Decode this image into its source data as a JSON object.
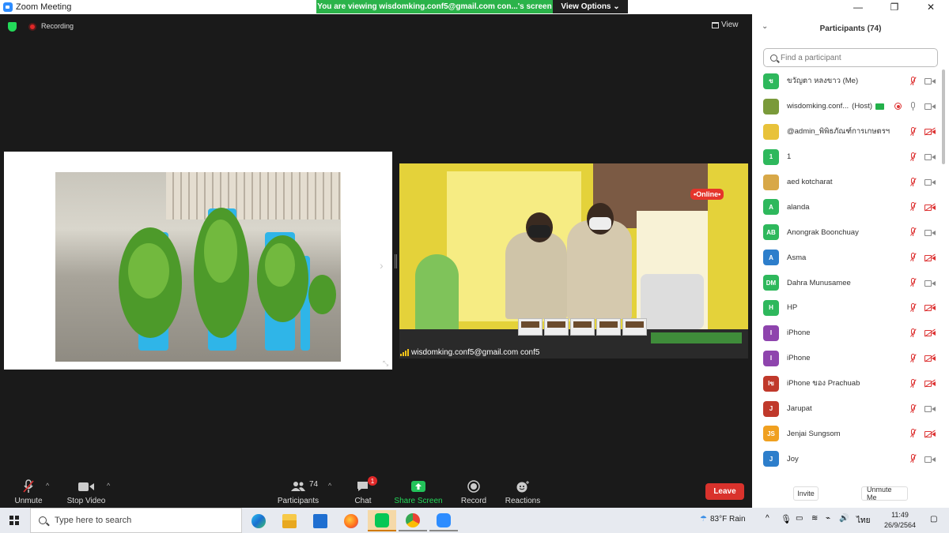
{
  "window": {
    "title": "Zoom Meeting",
    "minimize": "—",
    "maximize": "❐",
    "close": "✕"
  },
  "banner": {
    "text": "You are viewing wisdomking.conf5@gmail.com con...'s screen",
    "view_options": "View Options ⌄"
  },
  "meeting": {
    "recording_label": "Recording",
    "view_label": "View",
    "video_label": "wisdomking.conf5@gmail.com conf5",
    "video_sign_online": "•Online•"
  },
  "toolbar": {
    "unmute": "Unmute",
    "stop_video": "Stop Video",
    "participants": "Participants",
    "participants_count": "74",
    "chat": "Chat",
    "chat_badge": "1",
    "share_screen": "Share Screen",
    "record": "Record",
    "reactions": "Reactions",
    "leave": "Leave"
  },
  "panel": {
    "title": "Participants (74)",
    "search_placeholder": "Find a participant",
    "invite": "Invite",
    "unmute_me": "Unmute Me",
    "participants": [
      {
        "initials": "ข",
        "name": "ขวัญตา หลงขาว (Me)",
        "color": "#2eb85c",
        "mic": "muted",
        "cam": "on"
      },
      {
        "initials": "",
        "name": "wisdomking.conf...",
        "role": "(Host)",
        "color": "#7a9a3a",
        "mic": "on",
        "cam": "on",
        "sharing": true,
        "recording": true
      },
      {
        "initials": "",
        "name": "@admin_พิพิธภัณฑ์การเกษตรฯ",
        "color": "#e8c23a",
        "mic": "muted",
        "cam": "off"
      },
      {
        "initials": "1",
        "name": "1",
        "color": "#2eb85c",
        "mic": "muted",
        "cam": "on"
      },
      {
        "initials": "",
        "name": "aed kotcharat",
        "color": "#d8a848",
        "mic": "muted",
        "cam": "on"
      },
      {
        "initials": "A",
        "name": "alanda",
        "color": "#2eb85c",
        "mic": "muted",
        "cam": "off"
      },
      {
        "initials": "AB",
        "name": "Anongrak Boonchuay",
        "color": "#2eb85c",
        "mic": "muted",
        "cam": "on"
      },
      {
        "initials": "A",
        "name": "Asma",
        "color": "#2d7ecb",
        "mic": "muted",
        "cam": "off"
      },
      {
        "initials": "DM",
        "name": "Dahra Munusamee",
        "color": "#2eb85c",
        "mic": "muted",
        "cam": "on"
      },
      {
        "initials": "H",
        "name": "HP",
        "color": "#2eb85c",
        "mic": "muted",
        "cam": "off"
      },
      {
        "initials": "I",
        "name": "iPhone",
        "color": "#8e44ad",
        "mic": "muted",
        "cam": "off"
      },
      {
        "initials": "I",
        "name": "iPhone",
        "color": "#8e44ad",
        "mic": "muted",
        "cam": "off"
      },
      {
        "initials": "Iข",
        "name": "iPhone ของ Prachuab",
        "color": "#c0392b",
        "mic": "muted",
        "cam": "off"
      },
      {
        "initials": "J",
        "name": "Jarupat",
        "color": "#c0392b",
        "mic": "muted",
        "cam": "on"
      },
      {
        "initials": "JS",
        "name": "Jenjai Sungsom",
        "color": "#f0a020",
        "mic": "muted",
        "cam": "off"
      },
      {
        "initials": "J",
        "name": "Joy",
        "color": "#2d7ecb",
        "mic": "muted",
        "cam": "on"
      }
    ]
  },
  "taskbar": {
    "search_placeholder": "Type here to search",
    "weather": "83°F  Rain",
    "language": "ไทย",
    "time": "11:49",
    "date": "26/9/2564",
    "apps": [
      "edge-icon",
      "file-explorer-icon",
      "mail-icon",
      "firefox-icon",
      "line-icon",
      "chrome-icon",
      "zoom-icon"
    ]
  }
}
